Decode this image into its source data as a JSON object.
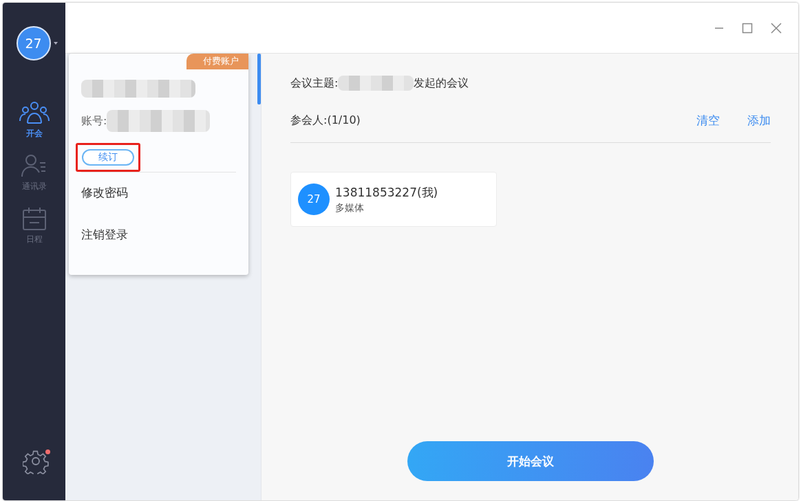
{
  "sidebar": {
    "avatar": "27",
    "items": [
      {
        "kind": "meeting",
        "label": "开会",
        "selected": true
      },
      {
        "kind": "contacts",
        "label": "通讯录",
        "selected": false
      },
      {
        "kind": "calendar",
        "label": "日程",
        "selected": false
      }
    ],
    "settings_badge": true
  },
  "account_menu": {
    "badge": "付费账户",
    "account_label": "账号:",
    "renew": "续订",
    "renew_highlighted": true,
    "items": [
      "修改密码",
      "注销登录"
    ]
  },
  "meeting": {
    "subject_label": "会议主题:",
    "subject_suffix": "发起的会议",
    "participants_label": "参会人:(1/10)",
    "actions": [
      "清空",
      "添加"
    ],
    "participants": [
      {
        "avatar": "27",
        "name": "13811853227(我)",
        "type": "多媒体"
      }
    ],
    "start_button": "开始会议"
  }
}
